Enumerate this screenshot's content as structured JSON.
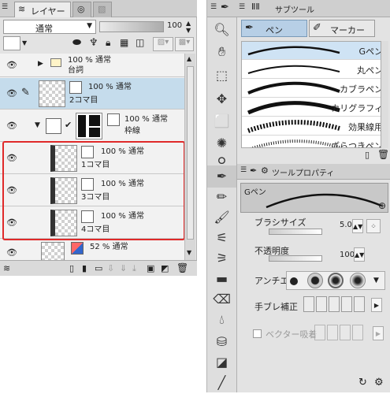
{
  "layer_panel": {
    "tabs": [
      {
        "label": "レイヤー",
        "icon": "layer-stack-icon"
      },
      {
        "label": "",
        "icon": "navigator-icon"
      },
      {
        "label": "",
        "icon": "layer-property-icon"
      }
    ],
    "blend_mode": "通常",
    "opacity": "100",
    "opacity_fraction": 1.0,
    "layers": [
      {
        "line1": "100 % 通常",
        "line2": "台詞",
        "type": "folder"
      },
      {
        "line1": "100 % 通常",
        "line2": "2コマ目",
        "type": "raster",
        "selected": true
      },
      {
        "line1": "100 % 通常",
        "line2": "枠線",
        "type": "frame-folder"
      },
      {
        "line1": "100 % 通常",
        "line2": "1コマ目",
        "type": "raster"
      },
      {
        "line1": "100 % 通常",
        "line2": "3コマ目",
        "type": "raster"
      },
      {
        "line1": "100 % 通常",
        "line2": "4コマ目",
        "type": "raster"
      },
      {
        "line1": "52 % 通常",
        "line2": "",
        "type": "raster"
      }
    ]
  },
  "subtool_panel": {
    "header_label": "サブツール",
    "tabs": [
      "ペン",
      "マーカー"
    ],
    "brushes": [
      "Gペン",
      "丸ペン",
      "カブラペン",
      "カリグラフィ",
      "効果線用",
      "ざらつきペン"
    ]
  },
  "prop_panel": {
    "header_label": "ツールプロパティ",
    "preview_name": "Gペン",
    "brush_size_label": "ブラシサイズ",
    "brush_size_value": "5.0",
    "opacity_label": "不透明度",
    "opacity_value": "100",
    "antialias_label": "アンチエ",
    "stabilize_label": "手ブレ補正",
    "vector_snap_label": "ベクター吸着"
  },
  "colors": {
    "selection": "#c5dcec",
    "highlight_box": "#e02a2a",
    "subtool_selected": "#cfe3f4"
  }
}
